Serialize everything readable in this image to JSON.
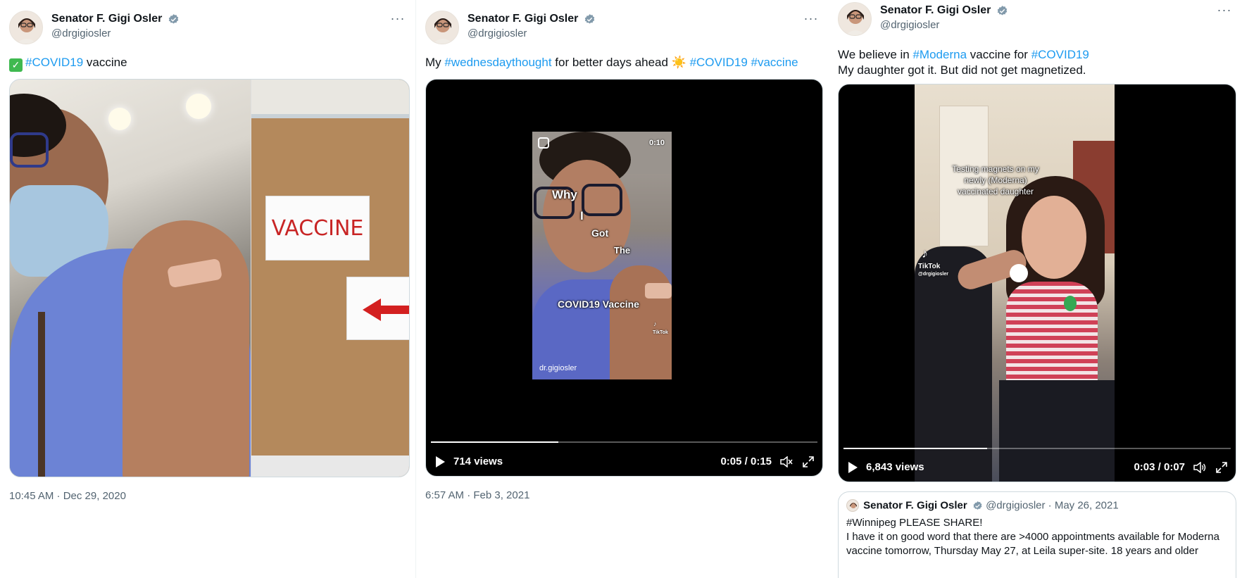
{
  "tweets": [
    {
      "author": {
        "name": "Senator F. Gigi Osler",
        "handle": "@drgigiosler"
      },
      "text": {
        "emoji": "✅",
        "tag1": "#COVID19",
        "rest": " vaccine"
      },
      "photo_sign": "VACCINE",
      "timestamp": "10:45 AM · Dec 29, 2020"
    },
    {
      "author": {
        "name": "Senator F. Gigi Osler",
        "handle": "@drgigiosler"
      },
      "text": {
        "pre": "My ",
        "tag1": "#wednesdaythought",
        "mid": " for better days ahead ☀️ ",
        "tag2": "#COVID19",
        "sp": " ",
        "tag3": "#vaccine"
      },
      "video": {
        "duration_chip": "0:10",
        "overlay": [
          "Why",
          "I",
          "Got",
          "The",
          "COVID19 Vaccine"
        ],
        "tiktok": "TikTok",
        "creator": "dr.gigiosler",
        "views": "714 views",
        "time": "0:05 / 0:15",
        "progress": 0.33
      },
      "timestamp": "6:57 AM · Feb 3, 2021"
    },
    {
      "author": {
        "name": "Senator F. Gigi Osler",
        "handle": "@drgigiosler"
      },
      "text": {
        "pre": "We believe in ",
        "tag1": "#Moderna",
        "mid": " vaccine for ",
        "tag2": "#COVID19",
        "line2": "My daughter got it. But did not get magnetized."
      },
      "video": {
        "caption": "Testing magnets on my newly (Moderna) vaccinated daughter",
        "tiktok": "TikTok",
        "tiktok_handle": "@drgigiosler",
        "views": "6,843 views",
        "time": "0:03 / 0:07",
        "progress": 0.37
      },
      "quote": {
        "name": "Senator F. Gigi Osler",
        "meta": "@drgigiosler · May 26, 2021",
        "line1": "#Winnipeg PLEASE SHARE!",
        "line2": "I have it on good word that there are >4000 appointments available for Moderna vaccine tomorrow, Thursday May 27, at Leila super-site. 18 years and older"
      }
    }
  ],
  "colors": {
    "link": "#1d9bf0",
    "secondary": "#536471",
    "verified": "#829aab"
  }
}
